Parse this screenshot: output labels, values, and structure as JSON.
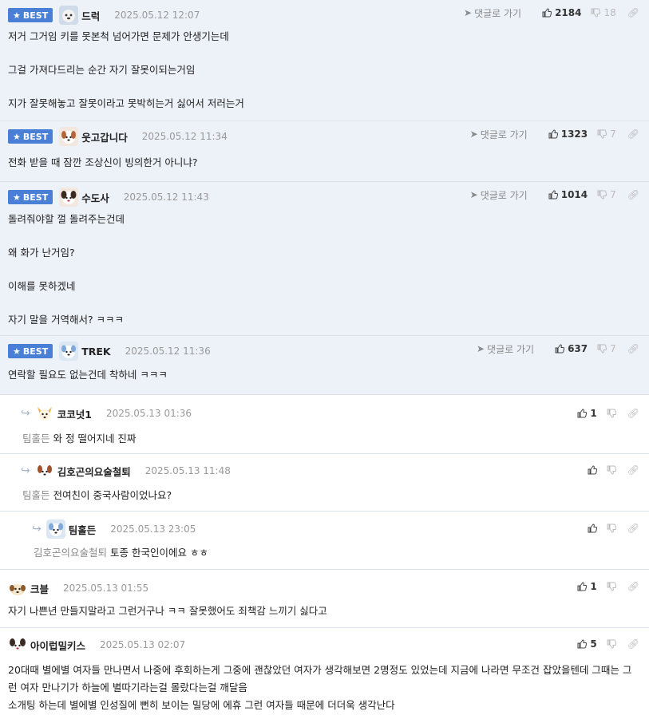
{
  "ui": {
    "best_label": "BEST",
    "goto_label": "댓글로 가기"
  },
  "comments": [
    {
      "nick": "드럭",
      "date": "2025.05.12 12:07",
      "up": "2184",
      "down": "18",
      "lines": [
        "저거 그거임 키를 못본척 넘어가면 문제가 안생기는데",
        "그걸 가져다드리는 순간 자기 잘못이되는거임",
        "지가 잘못해놓고 잘못이라고 못박히는거 싫어서 저러는거"
      ]
    },
    {
      "nick": "웃고갑니다",
      "date": "2025.05.12 11:34",
      "up": "1323",
      "down": "7",
      "lines": [
        "전화 받을 때 잠깐 조상신이 빙의한거 아니냐?"
      ]
    },
    {
      "nick": "수도사",
      "date": "2025.05.12 11:43",
      "up": "1014",
      "down": "7",
      "lines": [
        "돌려줘야할 껄 돌려주는건데",
        "왜 화가 난거임?",
        "이해를 못하겠네",
        "자기 말을 거역해서? ㅋㅋㅋ"
      ]
    },
    {
      "nick": "TREK",
      "date": "2025.05.12 11:36",
      "up": "637",
      "down": "7",
      "lines": [
        "연락할 필요도 없는건데 착하네 ㅋㅋㅋ"
      ]
    },
    {
      "nick": "코코넛1",
      "date": "2025.05.13 01:36",
      "up": "1",
      "down": "",
      "mention": "팀홀든",
      "text": "와 정 떨어지네 진짜"
    },
    {
      "nick": "김호곤의요술철퇴",
      "date": "2025.05.13 11:48",
      "up": "",
      "down": "",
      "mention": "팀홀든",
      "text": "전여친이 중국사람이었나요?"
    },
    {
      "nick": "팀홀든",
      "date": "2025.05.13 23:05",
      "up": "",
      "down": "",
      "mention": "김호곤의요술철퇴",
      "text": "토종 한국인이에요 ㅎㅎ"
    },
    {
      "nick": "크블",
      "date": "2025.05.13 01:55",
      "up": "1",
      "down": "",
      "text": "자기 나쁜년 만들지말라고 그런거구나 ㅋㅋ 잘못했어도 죄책감 느끼기 싫다고"
    },
    {
      "nick": "아이럽밀키스",
      "date": "2025.05.13 02:07",
      "up": "5",
      "down": "",
      "text": "20대때 별에별 여자들 만나면서 나중에 후회하는게 그중에 괜찮았던 여자가 생각해보면 2명정도 있었는데 지금에 나라면 무조건 잡았을텐데 그때는 그런 여자 만나기가 하늘에 별따기라는걸 몰랐다는걸 깨달음\n소개팅 하는데 별에별 인성질에 뻔히 보이는 밀당에 에휴 그런 여자들 때문에 더더욱 생각난다"
    }
  ],
  "colors": {
    "best_badge": "#4a7fd6",
    "best_bg": "#edf1f8",
    "border": "#dde3ec"
  },
  "icons": [
    "star-icon",
    "send-arrow-icon",
    "thumbs-up-icon",
    "thumbs-down-icon",
    "link-icon",
    "reply-arrow-icon",
    "avatar-icon"
  ]
}
